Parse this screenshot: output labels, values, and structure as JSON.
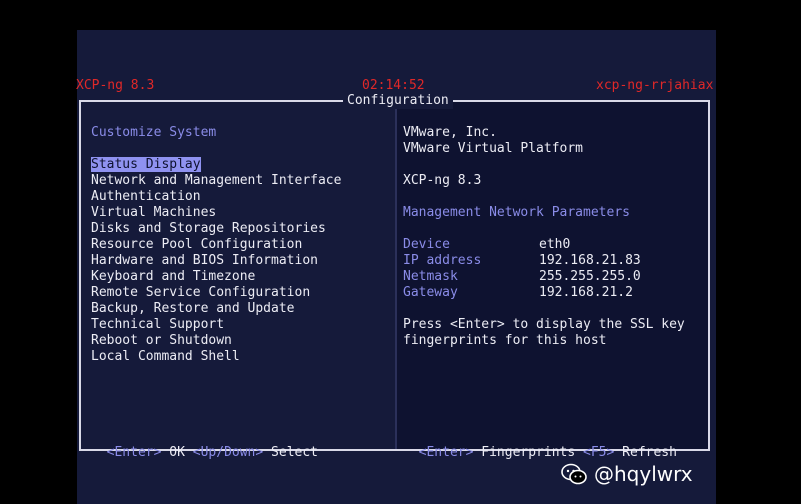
{
  "topbar": {
    "product_version": "XCP-ng 8.3",
    "clock": "02:14:52",
    "hostname": "xcp-ng-rrjahiax"
  },
  "dialog": {
    "title": "Configuration"
  },
  "menu": {
    "title": "Customize System",
    "selected_index": 0,
    "items": [
      "Status Display",
      "Network and Management Interface",
      "Authentication",
      "Virtual Machines",
      "Disks and Storage Repositories",
      "Resource Pool Configuration",
      "Hardware and BIOS Information",
      "Keyboard and Timezone",
      "Remote Service Configuration",
      "Backup, Restore and Update",
      "Technical Support",
      "Reboot or Shutdown",
      "Local Command Shell"
    ]
  },
  "status": {
    "vendor": "VMware, Inc.",
    "platform": "VMware Virtual Platform",
    "product": "XCP-ng 8.3",
    "network_title": "Management Network Parameters",
    "network": [
      {
        "label": "Device",
        "value": "eth0"
      },
      {
        "label": "IP address",
        "value": "192.168.21.83"
      },
      {
        "label": "Netmask",
        "value": "255.255.255.0"
      },
      {
        "label": "Gateway",
        "value": "192.168.21.2"
      }
    ],
    "ssl_line1": "Press <Enter> to display the SSL key",
    "ssl_line2": "fingerprints for this host"
  },
  "footer": {
    "left": [
      {
        "text": "<Enter>",
        "style": "blue"
      },
      {
        "text": " OK ",
        "style": "white"
      },
      {
        "text": "<Up/Down>",
        "style": "blue"
      },
      {
        "text": " Select",
        "style": "white"
      }
    ],
    "right": [
      {
        "text": "<Enter>",
        "style": "blue"
      },
      {
        "text": " Fingerprints ",
        "style": "white"
      },
      {
        "text": "<F5>",
        "style": "blue"
      },
      {
        "text": " Refresh",
        "style": "white"
      }
    ]
  },
  "watermark": {
    "text": "@hqylwrx",
    "icon": "wechat-icon"
  },
  "colors": {
    "accent_blue": "#8a8ce8",
    "header_red": "#e02828",
    "selection": "#8f92f0"
  }
}
